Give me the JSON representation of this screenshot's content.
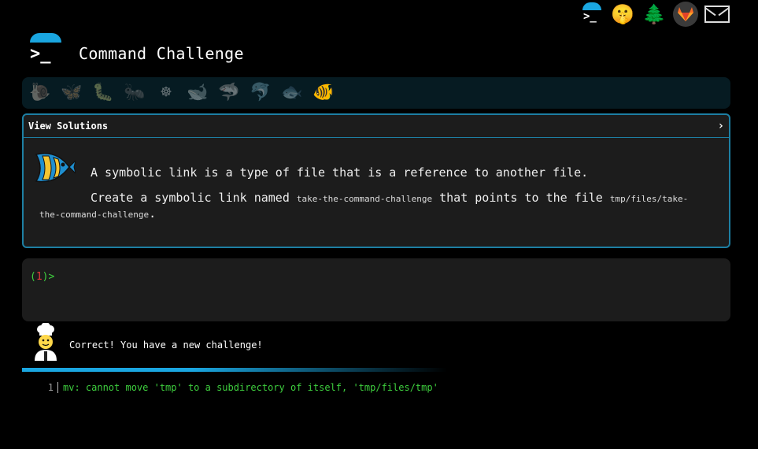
{
  "header": {
    "title": "Command Challenge",
    "logo_prompt": ">_"
  },
  "top_icons": [
    {
      "name": "command-challenge-logo-icon"
    },
    {
      "name": "shushing-face-icon",
      "glyph": "🤫"
    },
    {
      "name": "evergreen-tree-icon",
      "glyph": "🌲"
    },
    {
      "name": "gitlab-icon"
    },
    {
      "name": "envelope-icon"
    }
  ],
  "levels": [
    {
      "name": "snail",
      "glyph": "🐌",
      "active": false
    },
    {
      "name": "butterfly",
      "glyph": "🦋",
      "active": false
    },
    {
      "name": "caterpillar",
      "glyph": "🐛",
      "active": false
    },
    {
      "name": "ant",
      "glyph": "🐜",
      "active": false
    },
    {
      "name": "wheel",
      "glyph": "☸",
      "active": false
    },
    {
      "name": "whale",
      "glyph": "🐋",
      "active": false
    },
    {
      "name": "shark",
      "glyph": "🦈",
      "active": false
    },
    {
      "name": "dolphin",
      "glyph": "🐬",
      "active": false
    },
    {
      "name": "fish",
      "glyph": "🐟",
      "active": false
    },
    {
      "name": "tropical-fish",
      "glyph": "🐠",
      "active": true
    }
  ],
  "panel": {
    "header": "View Solutions",
    "chevron": "›",
    "description_line1": "A symbolic link is a type of file that is a reference to another file.",
    "desc2_pre": "Create a symbolic link named ",
    "desc2_code1": "take-the-command-challenge",
    "desc2_mid": " that points to the file ",
    "desc2_code2": "tmp/files/take-the-command-challenge",
    "desc2_post": "."
  },
  "terminal": {
    "prompt_open": "(",
    "prompt_num": "1",
    "prompt_close": ")>"
  },
  "feedback": {
    "message": "Correct! You have a new challenge!"
  },
  "output": {
    "lines": [
      {
        "num": "1",
        "text": "mv: cannot move 'tmp' to a subdirectory of itself, 'tmp/files/tmp'"
      }
    ]
  },
  "colors": {
    "accent": "#1aa6e0",
    "panel_border": "#1d7fa3",
    "success": "#3ecf3e",
    "error_num": "#e53a3a",
    "level_bar_bg": "#061b22"
  }
}
